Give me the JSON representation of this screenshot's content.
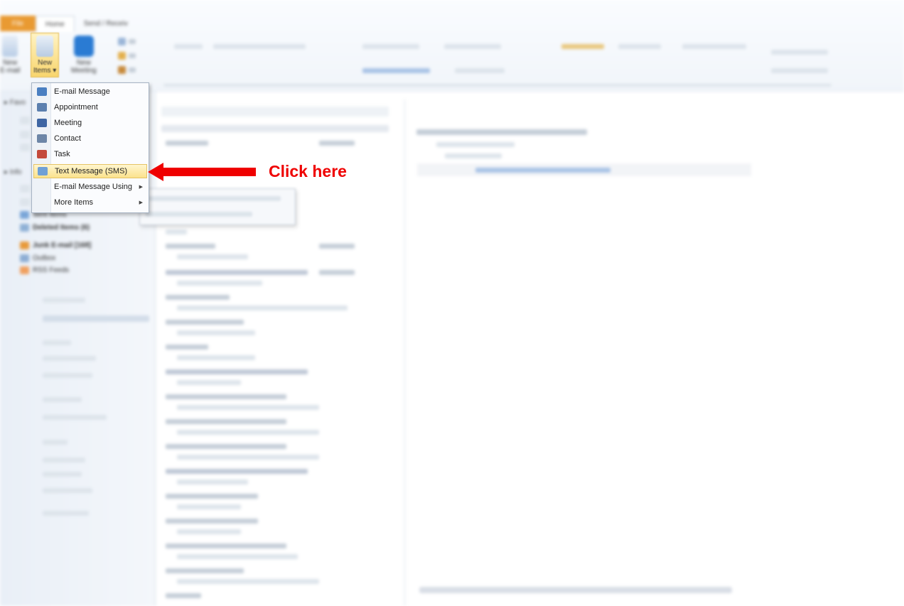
{
  "ribbon": {
    "tabs": {
      "file": "File",
      "home": "Home",
      "send_receive": "Send / Receiv"
    },
    "new_email": {
      "line1": "New",
      "line2": "E-mail"
    },
    "new_items": {
      "line1": "New",
      "line2": "Items ▾"
    },
    "new_meeting": {
      "line1": "New",
      "line2": "Meeting"
    }
  },
  "menu": {
    "items": [
      {
        "label": "E-mail Message",
        "icon": "email-message-icon",
        "color": "#4a7fc1"
      },
      {
        "label": "Appointment",
        "icon": "appointment-icon",
        "color": "#5b7fae"
      },
      {
        "label": "Meeting",
        "icon": "meeting-icon",
        "color": "#3f66a3"
      },
      {
        "label": "Contact",
        "icon": "contact-icon",
        "color": "#6d86a7"
      },
      {
        "label": "Task",
        "icon": "task-icon",
        "color": "#c44a3b"
      },
      {
        "label": "Text Message (SMS)",
        "icon": "sms-icon",
        "color": "#6fa0d6",
        "selected": true
      },
      {
        "label": "E-mail Message Using",
        "icon": "",
        "color": ""
      },
      {
        "label": "More Items",
        "icon": "",
        "color": ""
      }
    ]
  },
  "nav": {
    "favorites": "▸ Favo",
    "inbox_head": "▸ Info",
    "folders": [
      {
        "label": "Sent Items",
        "color": "#7aa6d8"
      },
      {
        "label": "Deleted Items (6)",
        "color": "#8fb1d6"
      },
      {
        "label": "Junk E-mail [168]",
        "color": "#e89a3a"
      },
      {
        "label": "Outbox",
        "color": "#8eaed4"
      },
      {
        "label": "RSS Feeds",
        "color": "#f0a060"
      }
    ]
  },
  "annotation": {
    "text": "Click here",
    "color": "#ef0000"
  }
}
